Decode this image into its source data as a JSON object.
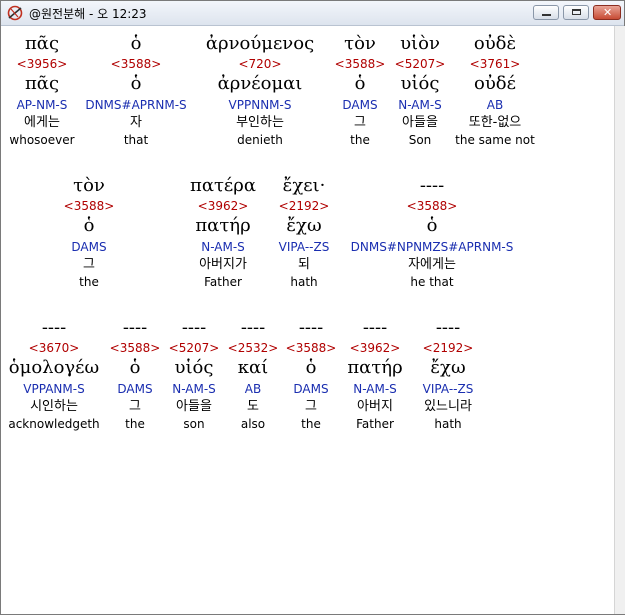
{
  "window": {
    "title": "@원전분해 - 오 12:23",
    "icon": "app-logo-icon",
    "controls": [
      "minimize-icon",
      "maximize-icon",
      "close-icon"
    ],
    "close_glyph": "✕"
  },
  "rows": [
    [
      {
        "greek": "πᾶς",
        "strong": "<3956>",
        "lemma": "πᾶς",
        "parse": "AP-NM-S",
        "korean": "에게는",
        "english": "whosoever"
      },
      {
        "greek": "ὁ",
        "strong": "<3588>",
        "lemma": "ὁ",
        "parse": "DNMS#APRNM-S",
        "korean": "자",
        "english": "that"
      },
      {
        "greek": "ἀρνούμενος",
        "strong": "<720>",
        "lemma": "ἀρνέομαι",
        "parse": "VPPNNM-S",
        "korean": "부인하는",
        "english": "denieth"
      },
      {
        "greek": "τὸν",
        "strong": "<3588>",
        "lemma": "ὁ",
        "parse": "DAMS",
        "korean": "그",
        "english": "the"
      },
      {
        "greek": "υἱὸν",
        "strong": "<5207>",
        "lemma": "υἱός",
        "parse": "N-AM-S",
        "korean": "아들을",
        "english": "Son"
      },
      {
        "greek": "οὐδὲ",
        "strong": "<3761>",
        "lemma": "οὐδέ",
        "parse": "AB",
        "korean": "또한-없으",
        "english": "the same not"
      }
    ],
    [
      {
        "greek": "τὸν",
        "strong": "<3588>",
        "lemma": "ὁ",
        "parse": "DAMS",
        "korean": "그",
        "english": "the"
      },
      {
        "greek": "πατέρα",
        "strong": "<3962>",
        "lemma": "πατήρ",
        "parse": "N-AM-S",
        "korean": "아버지가",
        "english": "Father"
      },
      {
        "greek": "ἔχει·",
        "strong": "<2192>",
        "lemma": "ἔχω",
        "parse": "VIPA--ZS",
        "korean": "되",
        "english": "hath"
      },
      {
        "greek": "----",
        "strong": "<3588>",
        "lemma": "ὁ",
        "parse": "DNMS#NPNMZS#APRNM-S",
        "korean": "자에게는",
        "english": "he that"
      }
    ],
    [
      {
        "greek": "----",
        "strong": "<3670>",
        "lemma": "ὁμολογέω",
        "parse": "VPPANM-S",
        "korean": "시인하는",
        "english": "acknowledgeth"
      },
      {
        "greek": "----",
        "strong": "<3588>",
        "lemma": "ὁ",
        "parse": "DAMS",
        "korean": "그",
        "english": "the"
      },
      {
        "greek": "----",
        "strong": "<5207>",
        "lemma": "υἱός",
        "parse": "N-AM-S",
        "korean": "아들을",
        "english": "son"
      },
      {
        "greek": "----",
        "strong": "<2532>",
        "lemma": "καί",
        "parse": "AB",
        "korean": "도",
        "english": "also"
      },
      {
        "greek": "----",
        "strong": "<3588>",
        "lemma": "ὁ",
        "parse": "DAMS",
        "korean": "그",
        "english": "the"
      },
      {
        "greek": "----",
        "strong": "<3962>",
        "lemma": "πατήρ",
        "parse": "N-AM-S",
        "korean": "아버지",
        "english": "Father"
      },
      {
        "greek": "----",
        "strong": "<2192>",
        "lemma": "ἔχω",
        "parse": "VIPA--ZS",
        "korean": "있느니라",
        "english": "hath"
      }
    ]
  ]
}
